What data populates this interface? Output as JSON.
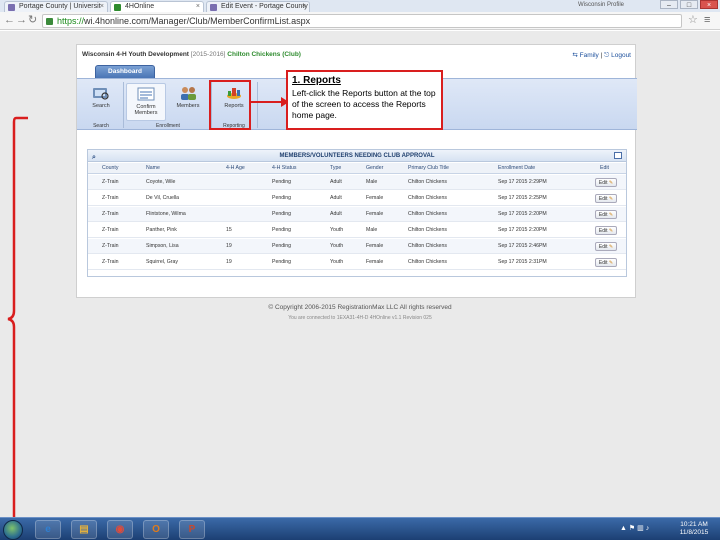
{
  "browser": {
    "tabs": [
      {
        "label": "Portage County | Universit",
        "favicon_color": "#7a6fb0"
      },
      {
        "label": "4HOnline",
        "favicon_color": "#2e8b2e"
      },
      {
        "label": "Edit Event - Portage County",
        "favicon_color": "#7a6fb0"
      }
    ],
    "window_user": "Wisconsin Profile",
    "url_scheme": "https://",
    "url_rest": "wi.4honline.com/Manager/Club/MemberConfirmList.aspx",
    "back_icon": "back-arrow-icon",
    "forward_icon": "forward-arrow-icon",
    "reload_icon": "reload-icon"
  },
  "page": {
    "org_name": "Wisconsin 4-H Youth Development",
    "year": "[2015-2016]",
    "club_name": "Chilton Chickens (Club)",
    "family_link": "Family",
    "logout_link": "Logout",
    "dashboard_tab": "Dashboard",
    "ribbon": {
      "search_btn": "Search",
      "search_group": "Search",
      "confirm_btn": "Confirm Members",
      "members_btn": "Members",
      "enrollment_group": "Enrollment",
      "reports_btn": "Reports",
      "reporting_group": "Reporting"
    },
    "table": {
      "title": "MEMBERS/VOLUNTEERS NEEDING CLUB APPROVAL",
      "headers": [
        "County",
        "Name",
        "4-H Age",
        "4-H Status",
        "Type",
        "Gender",
        "Primary Club Title",
        "Enrollment Date",
        "Edit"
      ],
      "rows": [
        {
          "county": "Z-Train",
          "name": "Coyote, Wile",
          "age": "",
          "status": "Pending",
          "type": "Adult",
          "gender": "Male",
          "club": "Chilton Chickens",
          "date": "Sep 17 2015 2:29PM",
          "edit": "Edit"
        },
        {
          "county": "Z-Train",
          "name": "De Vil, Cruella",
          "age": "",
          "status": "Pending",
          "type": "Adult",
          "gender": "Female",
          "club": "Chilton Chickens",
          "date": "Sep 17 2015 2:25PM",
          "edit": "Edit"
        },
        {
          "county": "Z-Train",
          "name": "Flintstone, Wilma",
          "age": "",
          "status": "Pending",
          "type": "Adult",
          "gender": "Female",
          "club": "Chilton Chickens",
          "date": "Sep 17 2015 2:20PM",
          "edit": "Edit"
        },
        {
          "county": "Z-Train",
          "name": "Panther, Pink",
          "age": "15",
          "status": "Pending",
          "type": "Youth",
          "gender": "Male",
          "club": "Chilton Chickens",
          "date": "Sep 17 2015 2:20PM",
          "edit": "Edit"
        },
        {
          "county": "Z-Train",
          "name": "Simpson, Lisa",
          "age": "19",
          "status": "Pending",
          "type": "Youth",
          "gender": "Female",
          "club": "Chilton Chickens",
          "date": "Sep 17 2015 2:46PM",
          "edit": "Edit"
        },
        {
          "county": "Z-Train",
          "name": "Squirrel, Gray",
          "age": "19",
          "status": "Pending",
          "type": "Youth",
          "gender": "Female",
          "club": "Chilton Chickens",
          "date": "Sep 17 2015 2:31PM",
          "edit": "Edit"
        }
      ]
    },
    "copyright": "© Copyright 2006-2015 RegistrationMax LLC All rights reserved",
    "connection": "You are connected to 1EXA31-4H-D  4HOnline v1.1 Revision 025"
  },
  "annotation": {
    "title": "1. Reports",
    "body": "Left-click the Reports button at the top of the screen to access the Reports home page.",
    "color": "#d91e1e"
  },
  "taskbar": {
    "apps": [
      {
        "icon": "internet-explorer-icon",
        "glyph": "e",
        "color": "#2f7fd1"
      },
      {
        "icon": "file-explorer-icon",
        "glyph": "▤",
        "color": "#e0b040"
      },
      {
        "icon": "chrome-icon",
        "glyph": "◉",
        "color": "#e04b3a"
      },
      {
        "icon": "outlook-icon",
        "glyph": "O",
        "color": "#e07b1a"
      },
      {
        "icon": "powerpoint-icon",
        "glyph": "P",
        "color": "#c8482c"
      }
    ],
    "time": "10:21 AM",
    "date": "11/8/2015"
  }
}
